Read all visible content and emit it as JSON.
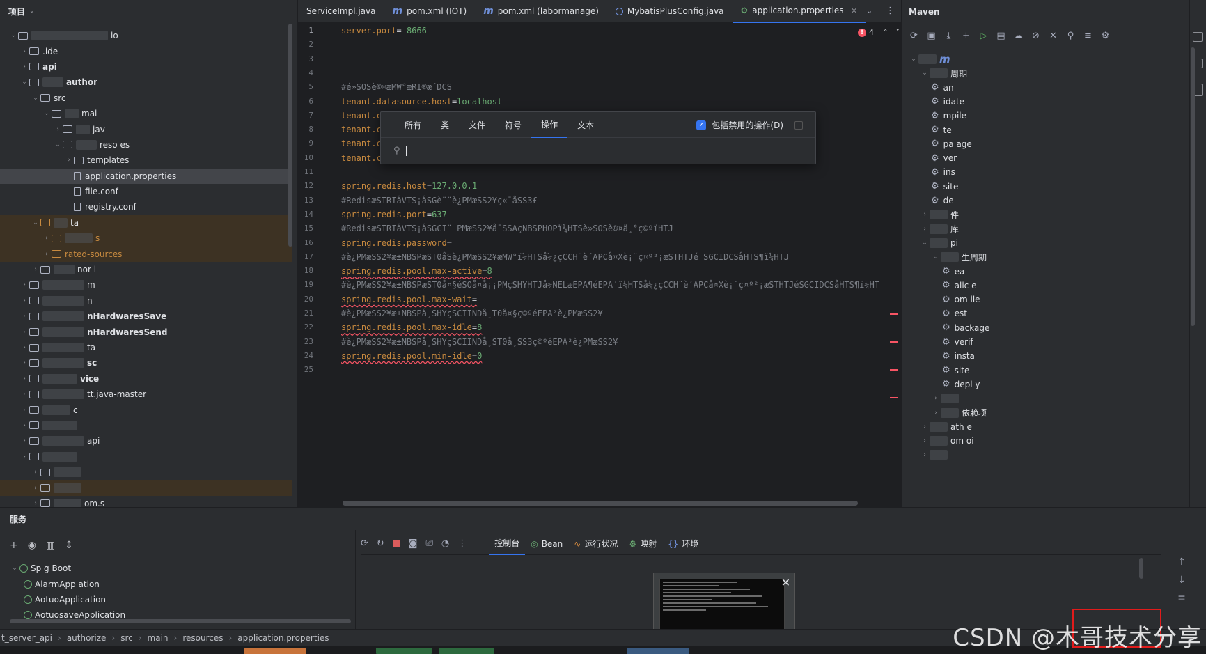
{
  "project": {
    "title": "项目",
    "items": [
      {
        "label": "io",
        "bold": false,
        "depth": 0,
        "expanded": true
      },
      {
        "label": ".ide",
        "bold": false,
        "depth": 1
      },
      {
        "label": "api",
        "bold": true,
        "depth": 1
      },
      {
        "label": "author",
        "bold": true,
        "depth": 1,
        "expanded": true
      },
      {
        "label": "src",
        "depth": 2,
        "expanded": true
      },
      {
        "label": "mai",
        "depth": 3,
        "expanded": true
      },
      {
        "label": "jav",
        "depth": 4
      },
      {
        "label": "reso",
        "suffix": "es",
        "depth": 4,
        "expanded": true
      },
      {
        "label": "templates",
        "depth": 5
      },
      {
        "label": "application.properties",
        "depth": 5,
        "selected": true
      },
      {
        "label": "file.conf",
        "depth": 5
      },
      {
        "label": "registry.conf",
        "depth": 5
      },
      {
        "label": "ta",
        "depth": 2,
        "expanded": true
      },
      {
        "label": "s",
        "depth": 3
      },
      {
        "label": "rated-sources",
        "depth": 3
      },
      {
        "label": "nor",
        "suffix": "l",
        "depth": 2
      },
      {
        "label": "m",
        "depth": 1
      },
      {
        "label": "n",
        "depth": 1
      },
      {
        "label": "nHardwaresSave",
        "depth": 1,
        "bold": true
      },
      {
        "label": "nHardwaresSend",
        "depth": 1,
        "bold": true
      },
      {
        "label": "ta",
        "depth": 1
      },
      {
        "label": "sc",
        "depth": 1,
        "bold": true
      },
      {
        "label": "vice",
        "depth": 1,
        "bold": true
      },
      {
        "label": "tt.java-master",
        "depth": 1
      },
      {
        "label": "c",
        "depth": 1
      },
      {
        "label": "",
        "depth": 1
      },
      {
        "label": "api",
        "depth": 1
      },
      {
        "label": "",
        "depth": 1
      },
      {
        "label": "",
        "depth": 2
      },
      {
        "label": "",
        "depth": 2
      },
      {
        "label": "om.s",
        "depth": 2
      }
    ]
  },
  "tabs": [
    {
      "label": "ServiceImpl.java",
      "icon": "java-class-icon"
    },
    {
      "label": "pom.xml (IOT)",
      "icon": "maven-icon"
    },
    {
      "label": "pom.xml (labormanage)",
      "icon": "maven-icon"
    },
    {
      "label": "MybatisPlusConfig.java",
      "icon": "java-class-icon"
    },
    {
      "label": "application.properties",
      "icon": "properties-icon",
      "active": true
    }
  ],
  "editor": {
    "error_count": "4",
    "lines": [
      {
        "n": "1",
        "key": "server.port",
        "val": "8666"
      },
      {
        "n": "2"
      },
      {
        "n": "3"
      },
      {
        "n": "4"
      },
      {
        "n": "5",
        "comment": "#é»SOSè®¤æMW°æRI®æ´DCS"
      },
      {
        "n": "6",
        "key": "tenant.datasource.host",
        "val": "localhost"
      },
      {
        "n": "7",
        "key": "tenant.c"
      },
      {
        "n": "8",
        "key": "tenant.c"
      },
      {
        "n": "9",
        "key": "tenant.c"
      },
      {
        "n": "10",
        "key": "tenant.c"
      },
      {
        "n": "11"
      },
      {
        "n": "12",
        "key": "spring.redis.host",
        "val": "127.0.0.1"
      },
      {
        "n": "13",
        "comment": "#RedisæSTRIåVTS¡åSGè¨¨è¿PMæSS2¥ç«¯åSS3£"
      },
      {
        "n": "14",
        "key": "spring.redis.port",
        "val": "637"
      },
      {
        "n": "15",
        "comment": "#RedisæSTRIåVTS¡åSGCI¨ PMæSS2¥å¯SSAçNBSPHOPï¼HTSè»SOSè®¤ä¸°ç©ºïHTJ"
      },
      {
        "n": "16",
        "key": "spring.redis.password",
        "val": ""
      },
      {
        "n": "17",
        "comment": "#è¿PMæSS2¥æ±NBSPæST0åSè¿PMæSS2¥æMW°ï¼HTSå¼¿çCCH¨è´APCå¤Xè¡¨ç¤º²¡æSTHTJé SGCIDCSåHTS¶ï¼HTJ",
        "err": false
      },
      {
        "n": "18",
        "key": "spring.redis.pool.max-active",
        "val": "8",
        "err": true
      },
      {
        "n": "19",
        "comment": "#è¿PMæSS2¥æ±NBSPæST0å¤§éSOå¤å¡¡PMçSHYHTJå¼NELæEPA¶éEPA´ï¼HTSå¼¿çCCH¨è´APCå¤Xè¡¨ç¤º²¡æSTHTJéSGCIDCSåHTS¶ï¼HT"
      },
      {
        "n": "20",
        "key": "spring.redis.pool.max-wait",
        "val": "",
        "err": true
      },
      {
        "n": "21",
        "comment": "#è¿PMæSS2¥æ±NBSPå¸SHYçSCIINDå¸T0å¤§ç©ºéEPA²è¿PMæSS2¥"
      },
      {
        "n": "22",
        "key": "spring.redis.pool.max-idle",
        "val": "8",
        "err": true
      },
      {
        "n": "23",
        "comment": "#è¿PMæSS2¥æ±NBSPå¸SHYçSCIINDå¸ST0å¸SS3ç©ºéEPA²è¿PMæSS2¥"
      },
      {
        "n": "24",
        "key": "spring.redis.pool.min-idle",
        "val": "0",
        "err": true
      },
      {
        "n": "25"
      }
    ]
  },
  "search_popup": {
    "tabs": [
      "所有",
      "类",
      "文件",
      "符号",
      "操作",
      "文本"
    ],
    "active_tab": "操作",
    "checkbox_label": "包括禁用的操作(D)",
    "query": ""
  },
  "maven": {
    "title": "Maven",
    "items": [
      {
        "label": "m",
        "depth": 0
      },
      {
        "label": "周期",
        "depth": 1
      },
      {
        "label": "an",
        "depth": 2,
        "gear": true
      },
      {
        "label": "idate",
        "depth": 2,
        "gear": true
      },
      {
        "label": "mpile",
        "depth": 2,
        "gear": true
      },
      {
        "label": "te",
        "depth": 2,
        "gear": true
      },
      {
        "label": "pa age",
        "depth": 2,
        "gear": true
      },
      {
        "label": "ver",
        "depth": 2,
        "gear": true
      },
      {
        "label": "ins",
        "depth": 2,
        "gear": true
      },
      {
        "label": "site",
        "depth": 2,
        "gear": true
      },
      {
        "label": "de",
        "depth": 2,
        "gear": true
      },
      {
        "label": "件",
        "depth": 1
      },
      {
        "label": "库",
        "depth": 1
      },
      {
        "label": "pi",
        "depth": 1
      },
      {
        "label": "生周期",
        "depth": 2
      },
      {
        "label": "ea",
        "depth": 3,
        "gear": true
      },
      {
        "label": "alic e",
        "depth": 3,
        "gear": true
      },
      {
        "label": "om ile",
        "depth": 3,
        "gear": true
      },
      {
        "label": "est",
        "depth": 3,
        "gear": true
      },
      {
        "label": "backage",
        "depth": 3,
        "gear": true
      },
      {
        "label": "verif",
        "depth": 3,
        "gear": true
      },
      {
        "label": "insta",
        "depth": 3,
        "gear": true
      },
      {
        "label": "site",
        "depth": 3,
        "gear": true
      },
      {
        "label": "depl y",
        "depth": 3,
        "gear": true
      },
      {
        "label": "",
        "depth": 2
      },
      {
        "label": "依赖项",
        "depth": 2
      },
      {
        "label": "ath e",
        "depth": 1
      },
      {
        "label": "om oi",
        "depth": 1
      },
      {
        "label": "",
        "depth": 1
      }
    ]
  },
  "services": {
    "title": "服务",
    "tree": [
      {
        "label": "Sp g Boot",
        "depth": 0
      },
      {
        "label": "AlarmApp ation",
        "depth": 1
      },
      {
        "label": "AotuoApplication",
        "depth": 1
      },
      {
        "label": "AotuosaveApplication",
        "depth": 1
      }
    ],
    "tabs": [
      "控制台",
      "Bean",
      "运行状况",
      "映射",
      "环境"
    ],
    "active_tab": "控制台"
  },
  "statusbar": {
    "crumbs": [
      "t_server_api",
      "authorize",
      "src",
      "main",
      "resources",
      "application.properties"
    ]
  },
  "watermark": "CSDN @木哥技术分享"
}
